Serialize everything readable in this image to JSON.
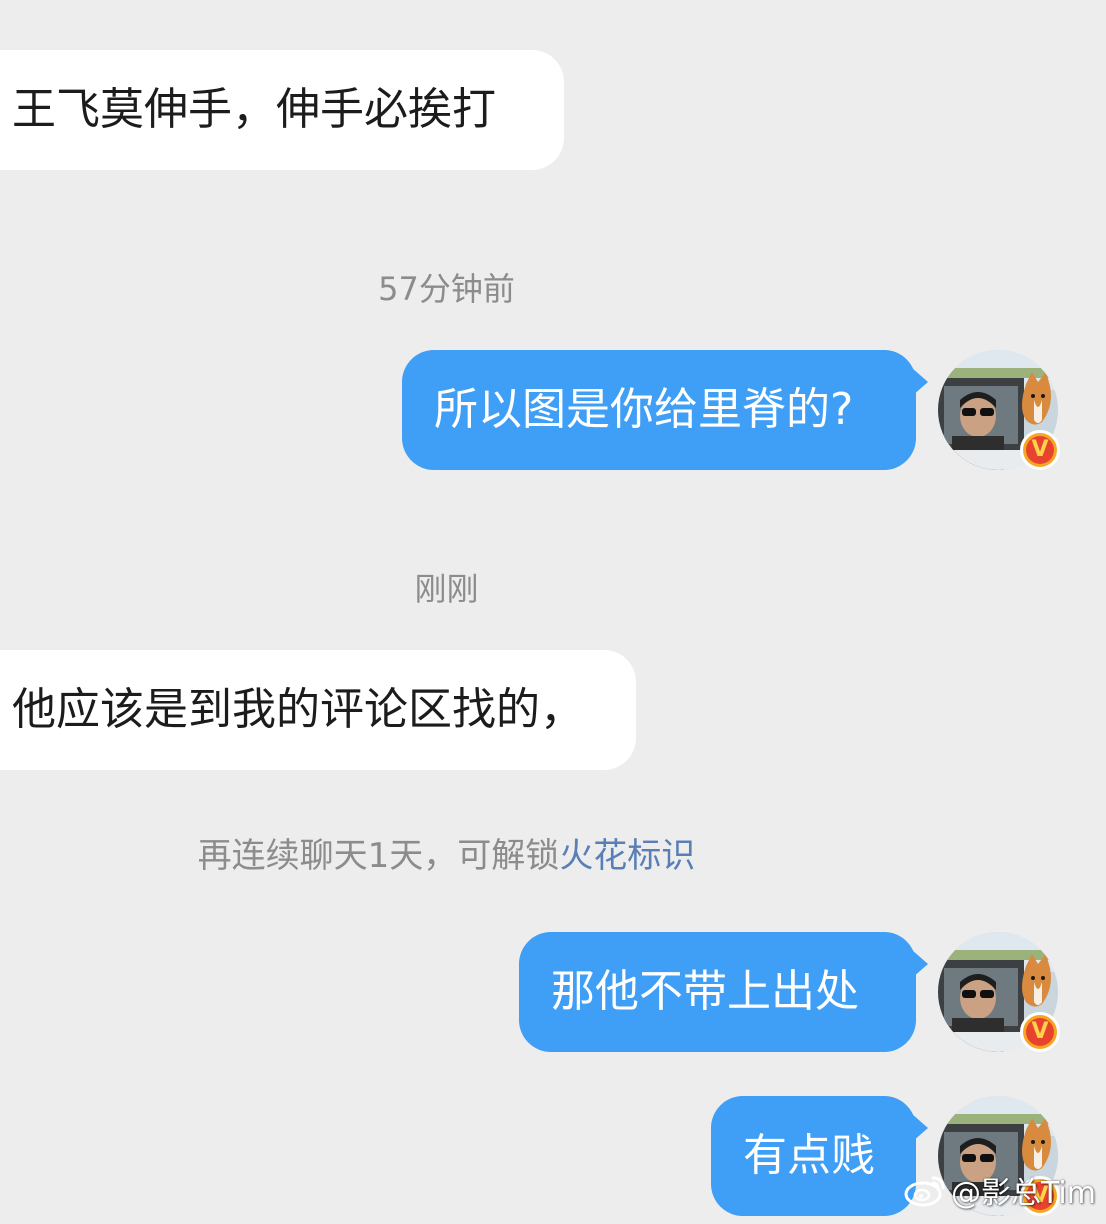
{
  "messages": [
    {
      "direction": "incoming",
      "text": "王飞莫伸手，伸手必挨打"
    },
    {
      "direction": "outgoing",
      "text": "所以图是你给里脊的?"
    },
    {
      "direction": "incoming",
      "text": "他应该是到我的评论区找的，"
    },
    {
      "direction": "outgoing",
      "text": "那他不带上出处"
    },
    {
      "direction": "outgoing",
      "text": "有点贱"
    }
  ],
  "timestamps": [
    "57分钟前",
    "刚刚"
  ],
  "system_tip": {
    "prefix": "再连续聊天1天，可解锁",
    "link": "火花标识"
  },
  "avatar": {
    "badge_letter": "V"
  },
  "watermark": {
    "text": "@影总Tim",
    "icon": "weibo-icon"
  },
  "colors": {
    "outgoing_bubble": "#3f9ef5",
    "incoming_bubble": "#ffffff",
    "background": "#ededed",
    "link": "#5a7fb6"
  }
}
